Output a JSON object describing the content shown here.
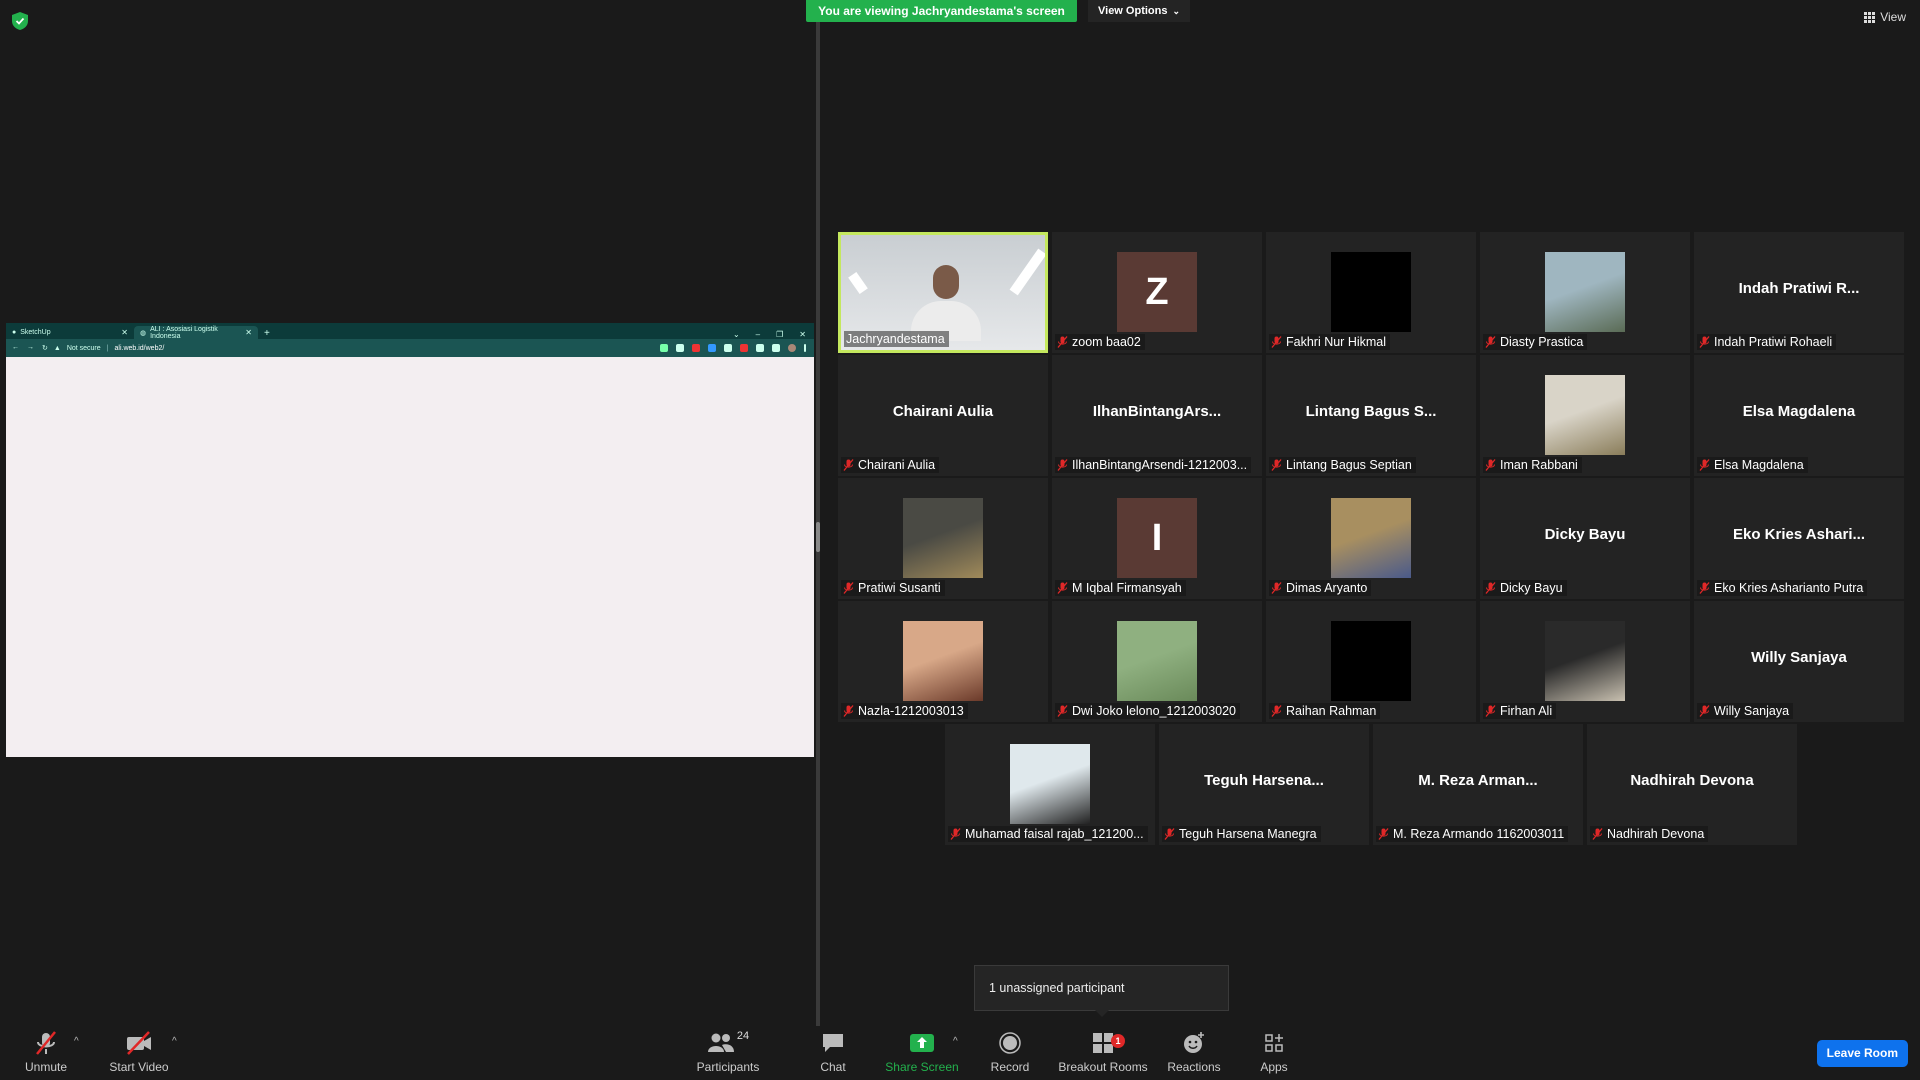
{
  "banner": {
    "viewing_text": "You are viewing Jachryandestama's screen",
    "view_options": "View Options",
    "view": "View"
  },
  "browser": {
    "tabs": [
      "SketchUp",
      "ALI : Asosiasi Logistik Indonesia"
    ],
    "not_secure": "Not secure",
    "url": "ali.web.id/web2/"
  },
  "participants": [
    {
      "label": "Jachryandestama",
      "display": "",
      "kind": "video"
    },
    {
      "label": "zoom baa02",
      "display": "Z",
      "kind": "letter"
    },
    {
      "label": "Fakhri Nur Hikmal",
      "display": "",
      "kind": "black"
    },
    {
      "label": "Diasty Prastica",
      "display": "",
      "kind": "photo"
    },
    {
      "label": "Indah Pratiwi Rohaeli",
      "display": "Indah Pratiwi R...",
      "kind": "text"
    },
    {
      "label": "Chairani Aulia",
      "display": "Chairani Aulia",
      "kind": "text"
    },
    {
      "label": "IlhanBintangArsendi-1212003...",
      "display": "IlhanBintangArs...",
      "kind": "text"
    },
    {
      "label": "Lintang Bagus Septian",
      "display": "Lintang Bagus S...",
      "kind": "text"
    },
    {
      "label": "Iman Rabbani",
      "display": "",
      "kind": "photo"
    },
    {
      "label": "Elsa Magdalena",
      "display": "Elsa Magdalena",
      "kind": "text"
    },
    {
      "label": "Pratiwi Susanti",
      "display": "",
      "kind": "photo"
    },
    {
      "label": "M Iqbal Firmansyah",
      "display": "I",
      "kind": "letter"
    },
    {
      "label": "Dimas Aryanto",
      "display": "",
      "kind": "photo"
    },
    {
      "label": "Dicky Bayu",
      "display": "Dicky Bayu",
      "kind": "text"
    },
    {
      "label": "Eko Kries Asharianto Putra",
      "display": "Eko Kries Ashari...",
      "kind": "text"
    },
    {
      "label": "Nazla-1212003013",
      "display": "",
      "kind": "photo"
    },
    {
      "label": "Dwi Joko lelono_1212003020",
      "display": "",
      "kind": "photo"
    },
    {
      "label": "Raihan Rahman",
      "display": "",
      "kind": "black"
    },
    {
      "label": "Firhan Ali",
      "display": "",
      "kind": "photo"
    },
    {
      "label": "Willy Sanjaya",
      "display": "Willy Sanjaya",
      "kind": "text"
    },
    {
      "label": "Muhamad faisal rajab_121200...",
      "display": "",
      "kind": "photo"
    },
    {
      "label": "Teguh Harsena Manegra",
      "display": "Teguh  Harsena...",
      "kind": "text"
    },
    {
      "label": "M. Reza Armando 1162003011",
      "display": "M. Reza Arman...",
      "kind": "text"
    },
    {
      "label": "Nadhirah Devona",
      "display": "Nadhirah Devona",
      "kind": "text"
    }
  ],
  "unassigned_tooltip": "1 unassigned participant",
  "toolbar": {
    "unmute": "Unmute",
    "start_video": "Start Video",
    "participants": "Participants",
    "participants_count": "24",
    "chat": "Chat",
    "share_screen": "Share Screen",
    "record": "Record",
    "breakout_rooms": "Breakout Rooms",
    "breakout_badge": "1",
    "reactions": "Reactions",
    "apps": "Apps",
    "leave_room": "Leave Room"
  },
  "colors": {
    "accent_green": "#23b14d",
    "active_speaker_border": "#c4e85e",
    "leave_blue": "#0e72ed",
    "muted_red": "#e02828"
  }
}
